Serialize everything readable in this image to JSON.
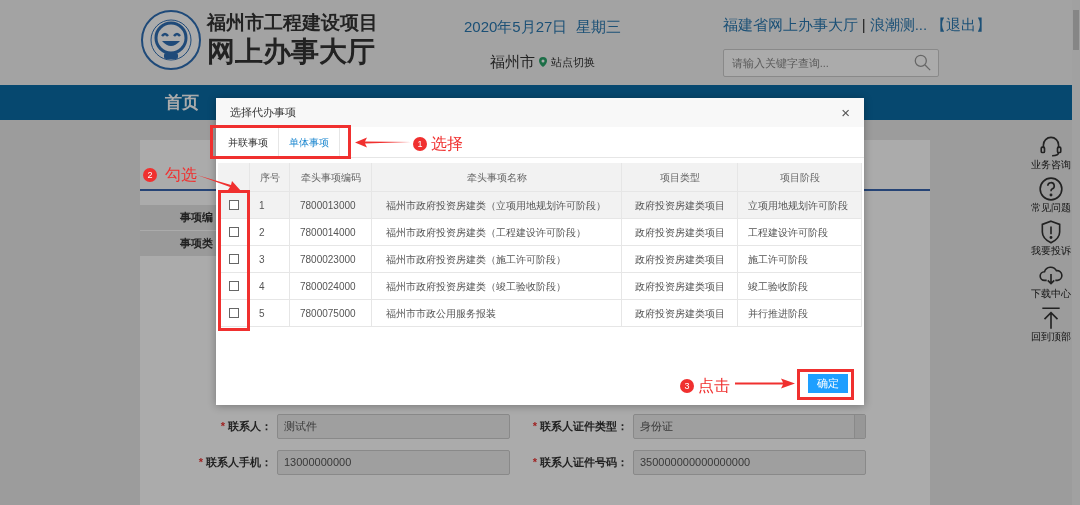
{
  "header": {
    "title": "福州市工程建设项目",
    "subtitle": "网上办事大厅",
    "date": "2020年5月27日  星期三",
    "city": "福州市",
    "switch_link": "站点切换",
    "portal_link": "福建省网上办事大厅",
    "separator": "|",
    "user": "浪潮测...",
    "logout": "【退出】",
    "search": {
      "placeholder": "请输入关键字查询..."
    }
  },
  "nav": [
    {
      "label": "首页"
    }
  ],
  "section_labels": [
    "事项编",
    "事项类"
  ],
  "form_rows": [
    [
      {
        "mark": "*",
        "label": "联系人：",
        "value": "测试件",
        "kind": "text"
      },
      {
        "mark": "*",
        "label": "联系人证件类型：",
        "value": "身份证",
        "kind": "select"
      }
    ],
    [
      {
        "mark": "*",
        "label": "联系人手机：",
        "value": "13000000000",
        "kind": "text"
      },
      {
        "mark": "*",
        "label": "联系人证件号码：",
        "value": "350000000000000000",
        "kind": "text"
      }
    ]
  ],
  "side_tools": [
    {
      "kind": "headset",
      "label": "业务咨询"
    },
    {
      "kind": "question",
      "label": "常见问题"
    },
    {
      "kind": "shield",
      "label": "我要投诉"
    },
    {
      "kind": "cloud",
      "label": "下载中心"
    },
    {
      "kind": "top",
      "label": "回到顶部"
    }
  ],
  "dialog": {
    "title": "选择代办事项",
    "close": "×",
    "tabs": [
      {
        "label": "并联事项",
        "selected": false
      },
      {
        "label": "单体事项",
        "selected": true
      }
    ],
    "columns": [
      "序号",
      "牵头事项编码",
      "牵头事项名称",
      "项目类型",
      "项目阶段"
    ],
    "rows": [
      {
        "no": "1",
        "code": "7800013000",
        "name": "福州市政府投资房建类（立项用地规划许可阶段）",
        "type": "政府投资房建类项目",
        "stage": "立项用地规划许可阶段",
        "checked": false,
        "hovered": true
      },
      {
        "no": "2",
        "code": "7800014000",
        "name": "福州市政府投资房建类（工程建设许可阶段）",
        "type": "政府投资房建类项目",
        "stage": "工程建设许可阶段",
        "checked": false,
        "hovered": false
      },
      {
        "no": "3",
        "code": "7800023000",
        "name": "福州市政府投资房建类（施工许可阶段）",
        "type": "政府投资房建类项目",
        "stage": "施工许可阶段",
        "checked": false,
        "hovered": false
      },
      {
        "no": "4",
        "code": "7800024000",
        "name": "福州市政府投资房建类（竣工验收阶段）",
        "type": "政府投资房建类项目",
        "stage": "竣工验收阶段",
        "checked": false,
        "hovered": false
      },
      {
        "no": "5",
        "code": "7800075000",
        "name": "福州市市政公用服务报装",
        "type": "政府投资房建类项目",
        "stage": "并行推进阶段",
        "checked": false,
        "hovered": false
      }
    ],
    "confirm": "确定"
  },
  "annotations": [
    {
      "number": "1",
      "text": "选择"
    },
    {
      "number": "2",
      "text": "勾选"
    },
    {
      "number": "3",
      "text": "点击"
    }
  ]
}
